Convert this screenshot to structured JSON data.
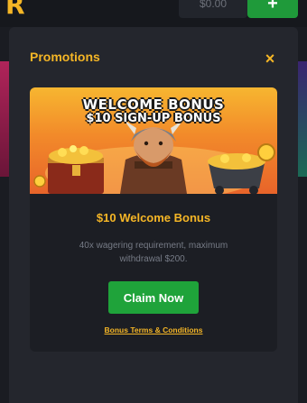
{
  "header": {
    "logo_text": "R",
    "balance": "$0.00",
    "add_funds_label": "+"
  },
  "modal": {
    "title": "Promotions",
    "close_label": "×"
  },
  "promo": {
    "banner_line1": "WELCOME BONUS",
    "banner_line2": "$10 SIGN-UP BONUS",
    "heading": "$10 Welcome Bonus",
    "description": "40x wagering requirement, maximum withdrawal $200.",
    "cta_label": "Claim Now",
    "terms_link": "Bonus Terms & Conditions"
  },
  "colors": {
    "accent": "#f5b626",
    "cta_green": "#1fa33a",
    "modal_bg": "#24262d",
    "card_bg": "#1c1e24"
  }
}
